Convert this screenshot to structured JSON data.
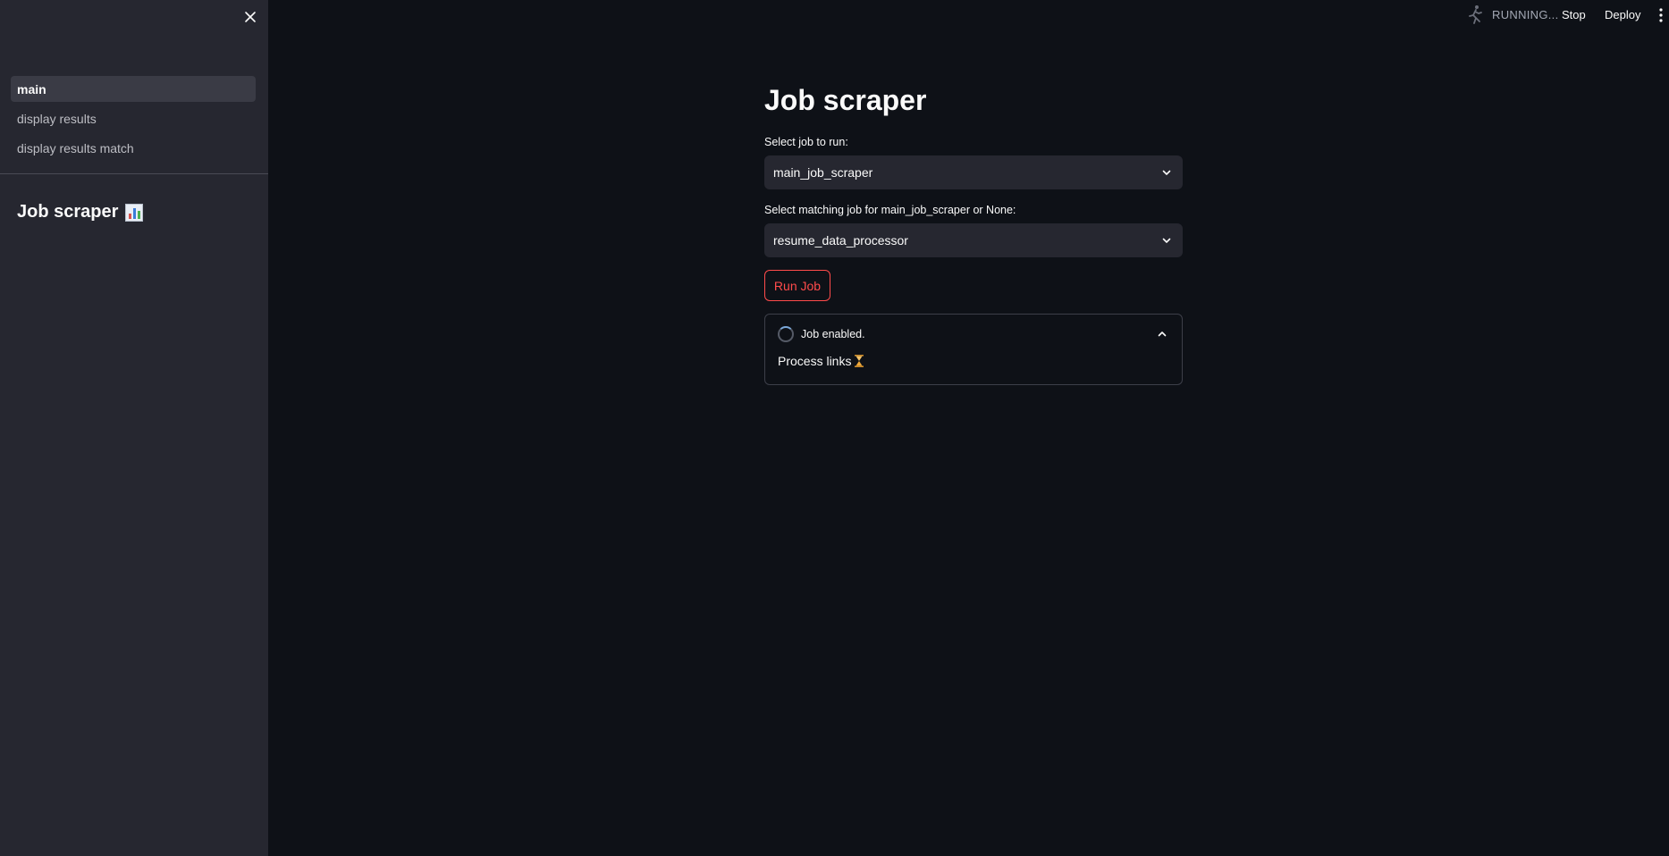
{
  "sidebar": {
    "nav_items": [
      {
        "label": "main",
        "active": true
      },
      {
        "label": "display results",
        "active": false
      },
      {
        "label": "display results match",
        "active": false
      }
    ],
    "title": "Job scraper",
    "title_icon": "bar-chart-emoji"
  },
  "header": {
    "status": "RUNNING...",
    "stop_label": "Stop",
    "deploy_label": "Deploy"
  },
  "main": {
    "title": "Job scraper",
    "job_select": {
      "label": "Select job to run:",
      "value": "main_job_scraper"
    },
    "match_select": {
      "label": "Select matching job for main_job_scraper or None:",
      "value": "resume_data_processor"
    },
    "run_button": "Run Job",
    "status": {
      "label": "Job enabled.",
      "body": "Process links",
      "body_icon": "hourglass-emoji"
    }
  },
  "colors": {
    "background": "#0e1117",
    "sidebar": "#262730",
    "accent": "#ff4b4b"
  }
}
